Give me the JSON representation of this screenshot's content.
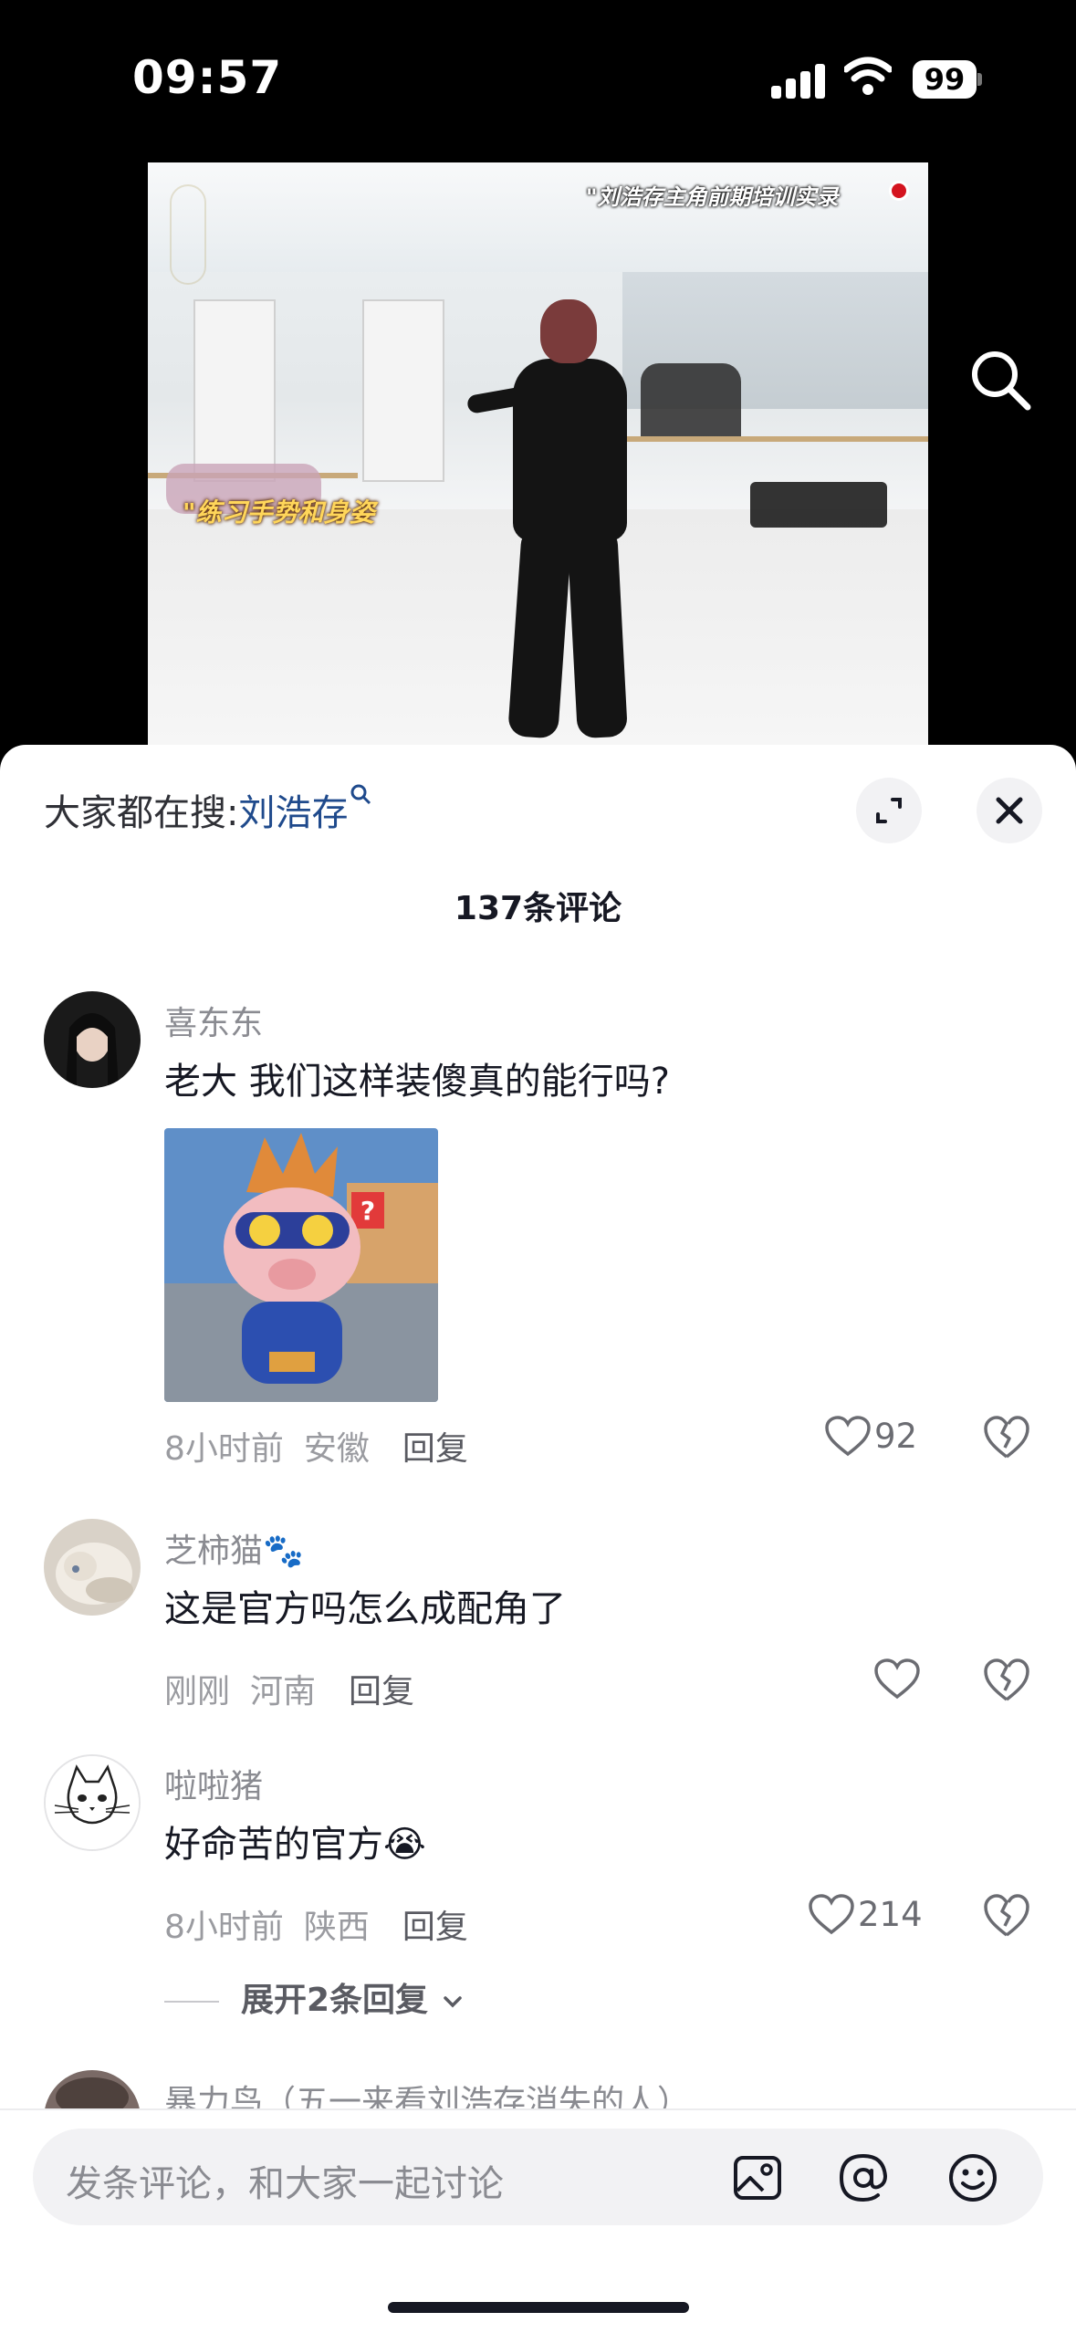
{
  "status_bar": {
    "time": "09:57",
    "battery": "99"
  },
  "video": {
    "caption_top": "\"刘浩存主角前期培训实录",
    "caption_mid": "\"练习手势和身姿"
  },
  "comments_panel": {
    "search_hint_label": "大家都在搜:",
    "search_hint_keyword": "刘浩存",
    "comment_count": "137条评论",
    "comments": [
      {
        "author": "喜东东",
        "text": "老大 我们这样装傻真的能行吗?",
        "time": "8小时前",
        "location": "安徽",
        "reply": "回复",
        "likes": "92"
      },
      {
        "author": "芝柿猫🐾",
        "text": "这是官方吗怎么成配角了",
        "time": "刚刚",
        "location": "河南",
        "reply": "回复",
        "likes": ""
      },
      {
        "author": "啦啦猪",
        "text": "好命苦的官方😭",
        "time": "8小时前",
        "location": "陕西",
        "reply": "回复",
        "likes": "214",
        "expand": "展开2条回复"
      },
      {
        "author": "暴力鸟（五一来看刘浩存消失的人）"
      }
    ]
  },
  "input_bar": {
    "placeholder": "发条评论，和大家一起讨论"
  },
  "icons": {
    "search": "search-icon",
    "expand": "expand-icon",
    "close": "close-icon",
    "like": "heart-icon",
    "dislike": "broken-heart-icon",
    "image": "image-icon",
    "mention": "at-icon",
    "emoji": "emoji-icon"
  }
}
